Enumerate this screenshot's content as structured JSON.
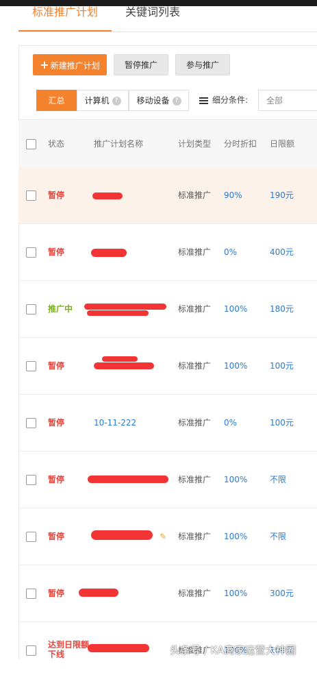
{
  "tabs": [
    {
      "label": "标准推广计划",
      "active": true
    },
    {
      "label": "关键词列表",
      "active": false
    }
  ],
  "toolbar": {
    "new_plan_label": "新建推广计划",
    "pause_label": "暂停推广",
    "join_label": "参与推广"
  },
  "segments": [
    {
      "label": "汇总",
      "active": true
    },
    {
      "label": "计算机",
      "active": false
    },
    {
      "label": "移动设备",
      "active": false
    }
  ],
  "filter": {
    "label": "细分条件:",
    "select_value": "全部"
  },
  "table": {
    "headers": [
      "状态",
      "推广计划名称",
      "计划类型",
      "分时折扣",
      "日限额"
    ],
    "rows": [
      {
        "status": "暂停",
        "name": "",
        "type": "标准推广",
        "discount": "90%",
        "limit": "190元"
      },
      {
        "status": "暂停",
        "name": "",
        "type": "标准推广",
        "discount": "0%",
        "limit": "400元"
      },
      {
        "status": "推广中",
        "name": "",
        "type": "标准推广",
        "discount": "100%",
        "limit": "180元"
      },
      {
        "status": "暂停",
        "name": "",
        "type": "标准推广",
        "discount": "100%",
        "limit": "100元"
      },
      {
        "status": "暂停",
        "name": "10-11-222",
        "type": "标准推广",
        "discount": "0%",
        "limit": "100元"
      },
      {
        "status": "暂停",
        "name": "",
        "type": "标准推广",
        "discount": "100%",
        "limit": "不限"
      },
      {
        "status": "暂停",
        "name": "",
        "type": "标准推广",
        "discount": "100%",
        "limit": "不限"
      },
      {
        "status": "暂停",
        "name": "",
        "type": "标准推广",
        "discount": "100%",
        "limit": "300元"
      },
      {
        "status": "达到日限额 下线",
        "name": "",
        "type": "标准推广",
        "discount": "100%",
        "limit": "100元"
      }
    ]
  },
  "watermark": "头条号 / KA商家运营大神圈",
  "colors": {
    "accent": "#f5822c",
    "paused": "#e8453c",
    "running": "#7ab317",
    "link": "#2a7bd1",
    "highlight_row": "#fcf2ea"
  }
}
